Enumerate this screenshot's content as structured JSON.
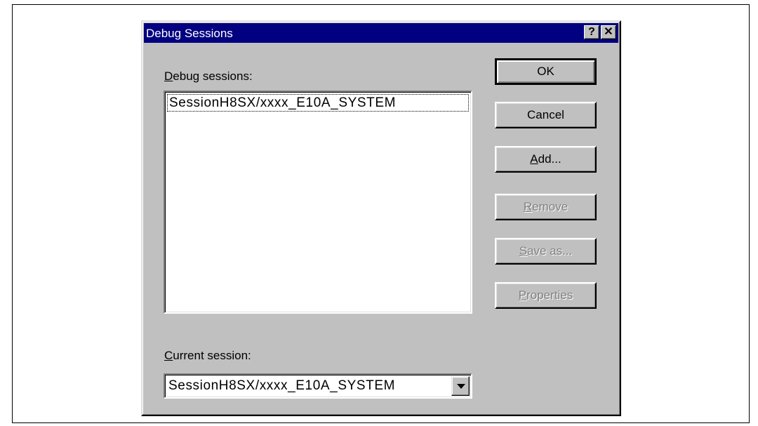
{
  "window": {
    "title": "Debug Sessions",
    "help_glyph": "?",
    "close_glyph": "✕"
  },
  "debug_sessions": {
    "label_mnemonic": "D",
    "label_rest": "ebug sessions:",
    "items": [
      "SessionH8SX/xxxx_E10A_SYSTEM"
    ]
  },
  "buttons": {
    "ok": "OK",
    "cancel": "Cancel",
    "add_mnemonic": "A",
    "add_rest": "dd...",
    "remove_mnemonic": "R",
    "remove_rest": "emove",
    "save_as_mnemonic": "S",
    "save_as_rest": "ave as...",
    "properties_mnemonic": "P",
    "properties_rest": "roperties"
  },
  "current_session": {
    "label_mnemonic": "C",
    "label_rest": "urrent session:",
    "value": "SessionH8SX/xxxx_E10A_SYSTEM"
  },
  "colors": {
    "titlebar": "#000080",
    "dialog_face": "#c0c0c0",
    "disabled_text": "#808080"
  }
}
